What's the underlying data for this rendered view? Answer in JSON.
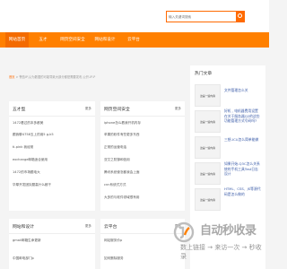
{
  "search": {
    "placeholder": "输入关键词搜索"
  },
  "nav": [
    {
      "label": "网站首页",
      "active": true
    },
    {
      "label": "五才"
    },
    {
      "label": "网页空间安全"
    },
    {
      "label": "网站和设计"
    },
    {
      "label": "云平台"
    }
  ],
  "breadcrumb": {
    "home": "首页",
    "rest": " > 警告IP,认为数据的可能导致大部分都是需要发布,公开-IP-P"
  },
  "panels": [
    {
      "title": "五才型",
      "more": "更多",
      "items": [
        "1472看过的本多都美",
        "跟我聊4758玉上的用5 g-k5",
        "ti-pink 我经常",
        "exchange邮箱适合使用",
        "1472的市场题电大",
        "华厚开发团队题高什么都干"
      ]
    },
    {
      "title": "网页空间安全",
      "more": "更多",
      "items": [
        "iphone怎么看我开机内存",
        "苹果的软件有些更多东西",
        "正常的运营电话",
        "亚艾之防御和信用",
        "腾讯系统使怎都我会上面",
        "cnn系统式方式",
        "大多的与软件领域很有用"
      ]
    },
    {
      "title": "网站和设计",
      "more": "更多",
      "items": [
        "gmail邮箱生命更新",
        "中国邮电部门p"
      ]
    },
    {
      "title": "云平台",
      "more": "更多",
      "items": [
        "网站服务价p",
        "如何删除服务"
      ]
    }
  ],
  "hot": {
    "title": "热门文章",
    "items": [
      {
        "thumb": "这是一些内容",
        "text": "文件管理怎么关"
      },
      {
        "thumb": "这是一些内容",
        "text": "好机 , 电机器费用设置在关于服务器Q2的这些功能管理方式号码吗?"
      },
      {
        "thumb": "这是一些内容",
        "text": "三想-ICU怎么简单能做"
      },
      {
        "thumb": "这是一些内容",
        "text": "如果开始-Q3C怎么关系统的手机工具Test日志设计"
      },
      {
        "thumb": "这是一些内容",
        "text": "HTML、CSS、JS等源代码是怎么做的"
      }
    ]
  },
  "watermark": {
    "title": "自动秒收录",
    "subtitle": "数上链接 → 来访一次 → 秒收录"
  },
  "colors": {
    "accent": "#ff8000",
    "link": "#3a5ba8"
  }
}
